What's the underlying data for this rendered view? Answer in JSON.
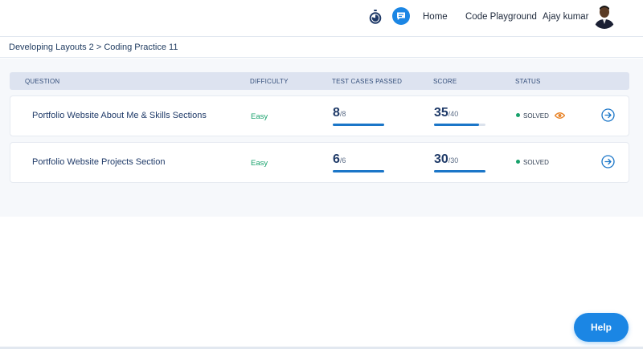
{
  "header": {
    "nav": {
      "home": "Home",
      "code_playground": "Code Playground"
    },
    "user_name": "Ajay kumar",
    "icons": {
      "timer": "timer-icon",
      "chat": "chat-icon"
    }
  },
  "breadcrumb": "Developing Layouts 2 > Coding Practice 11",
  "table": {
    "columns": [
      "QUESTION",
      "DIFFICULTY",
      "TEST CASES PASSED",
      "SCORE",
      "STATUS"
    ],
    "rows": [
      {
        "question": "Portfolio Website About Me & Skills Sections",
        "difficulty": "Easy",
        "test_cases_passed": "8",
        "test_cases_total": "/8",
        "test_cases_progress": 1.0,
        "score": "35",
        "score_total": "/40",
        "score_progress": 0.875,
        "status": "SOLVED",
        "has_view_icon": true
      },
      {
        "question": "Portfolio Website Projects Section",
        "difficulty": "Easy",
        "test_cases_passed": "6",
        "test_cases_total": "/6",
        "test_cases_progress": 1.0,
        "score": "30",
        "score_total": "/30",
        "score_progress": 1.0,
        "status": "SOLVED",
        "has_view_icon": false
      }
    ]
  },
  "help_button": "Help",
  "colors": {
    "accent": "#1b86e4",
    "progress": "#1b76c8",
    "easy": "#17a16b",
    "solved_dot": "#17a16b",
    "view_icon": "#e8852a",
    "header_bg": "#dde3f0"
  }
}
